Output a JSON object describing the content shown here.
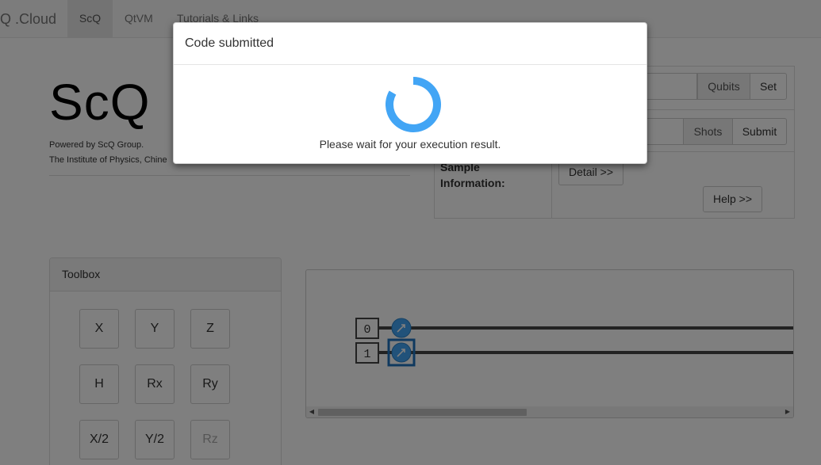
{
  "navbar": {
    "brand": "Q .Cloud",
    "items": [
      {
        "label": "ScQ",
        "active": true
      },
      {
        "label": "QtVM",
        "active": false
      },
      {
        "label": "Tutorials & Links",
        "active": false
      }
    ]
  },
  "header": {
    "logo": "ScQ",
    "powered_by": "Powered by ScQ Group.",
    "institute": "The Institute of Physics, Chine"
  },
  "controls": {
    "qubits_label": "Qubits",
    "set_label": "Set",
    "shots_label": "Shots",
    "submit_label": "Submit",
    "sample_info_label": "Sample Information:",
    "detail_label": "Detail >>",
    "help_label": "Help >>"
  },
  "toolbox": {
    "title": "Toolbox",
    "gates": [
      {
        "label": "X",
        "enabled": true
      },
      {
        "label": "Y",
        "enabled": true
      },
      {
        "label": "Z",
        "enabled": true
      },
      {
        "label": "H",
        "enabled": true
      },
      {
        "label": "Rx",
        "enabled": true
      },
      {
        "label": "Ry",
        "enabled": true
      },
      {
        "label": "X/2",
        "enabled": true
      },
      {
        "label": "Y/2",
        "enabled": true
      },
      {
        "label": "Rz",
        "enabled": false
      }
    ]
  },
  "circuit": {
    "qubits": [
      "0",
      "1"
    ],
    "measure_icon": "measure-icon"
  },
  "modal": {
    "title": "Code submitted",
    "message": "Please wait for your execution result.",
    "spinner_color": "#42a5f5"
  }
}
